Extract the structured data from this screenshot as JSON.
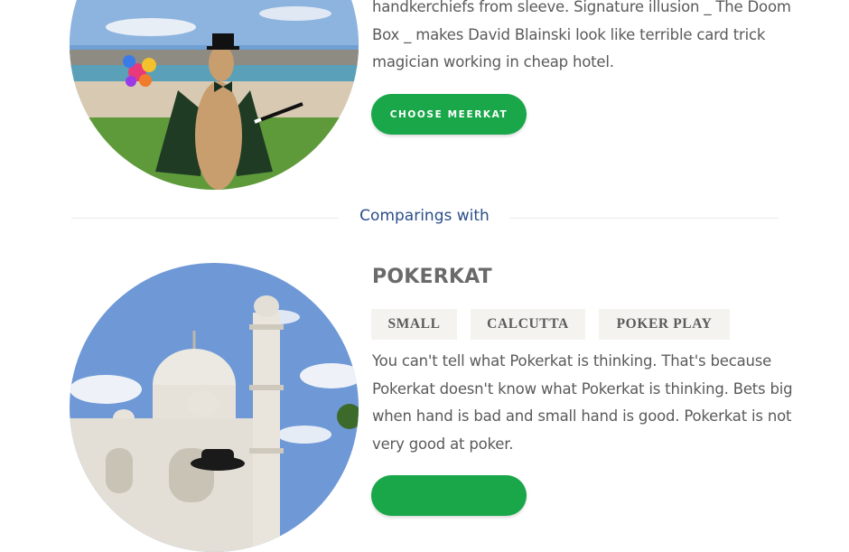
{
  "top_card": {
    "description_lines": [
      "handkerchiefs from sleeve. Signature illusion _ The Doom",
      "Box _ makes David Blainski look like terrible card trick",
      "magician working in cheap hotel."
    ],
    "button_label": "CHOOSE MEERKAT"
  },
  "divider": {
    "label": "Comparings with"
  },
  "compare_card": {
    "name": "POKERKAT",
    "tags": [
      "SMALL",
      "CALCUTTA",
      "POKER  PLAY"
    ],
    "description_lines": [
      "You can't tell what Pokerkat is thinking. That's because",
      "Pokerkat doesn't know what Pokerkat is thinking. Bets big",
      "when hand is bad and small hand is good. Pokerkat is not",
      "very good at poker."
    ]
  },
  "colors": {
    "accent_green": "#19a74a",
    "divider_text": "#2a4e8a"
  }
}
